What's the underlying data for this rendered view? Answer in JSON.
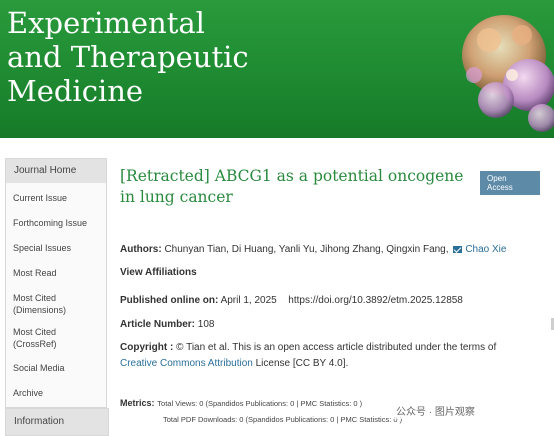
{
  "journal": {
    "title_lines": [
      "Experimental",
      "and Therapeutic",
      "Medicine"
    ]
  },
  "sidebar": {
    "header": "Journal Home",
    "items": [
      {
        "label": "Current Issue"
      },
      {
        "label": "Forthcoming Issue"
      },
      {
        "label": "Special Issues"
      },
      {
        "label": "Most Read"
      },
      {
        "label": "Most Cited (Dimensions)"
      },
      {
        "label": "Most Cited (CrossRef)"
      },
      {
        "label": "Social Media"
      },
      {
        "label": "Archive"
      }
    ],
    "header2": "Information"
  },
  "article": {
    "title": "[Retracted] ABCG1 as a potential oncogene in lung cancer",
    "badge": "Open Access",
    "authors_label": "Authors:",
    "authors": "Chunyan Tian, Di Huang, Yanli Yu, Jihong Zhang, Qingxin Fang,",
    "corresponding_author": "Chao Xie",
    "affiliations_link": "View Affiliations",
    "published_label": "Published online on:",
    "published_date": "April 1, 2025",
    "doi": "https://doi.org/10.3892/etm.2025.12858",
    "article_number_label": "Article Number:",
    "article_number": "108",
    "copyright_label": "Copyright :",
    "copyright_text": "© Tian et al. This is an open access article distributed under the terms of",
    "license_link": "Creative Commons Attribution",
    "license_suffix": "License [CC BY 4.0].",
    "metrics_label": "Metrics:",
    "metrics_views": "Total Views: 0 (Spandidos Publications: 0 | PMC Statistics: 0 )",
    "metrics_downloads": "Total PDF Downloads: 0 (Spandidos Publications: 0 | PMC Statistics: 0 )"
  },
  "overlay": {
    "watermark": "公众号 · 图片观察"
  },
  "colors": {
    "banner": "#1e8a31",
    "title_green": "#2a8a3e",
    "link_blue": "#2a6f9a",
    "badge": "#5c8aa7"
  }
}
